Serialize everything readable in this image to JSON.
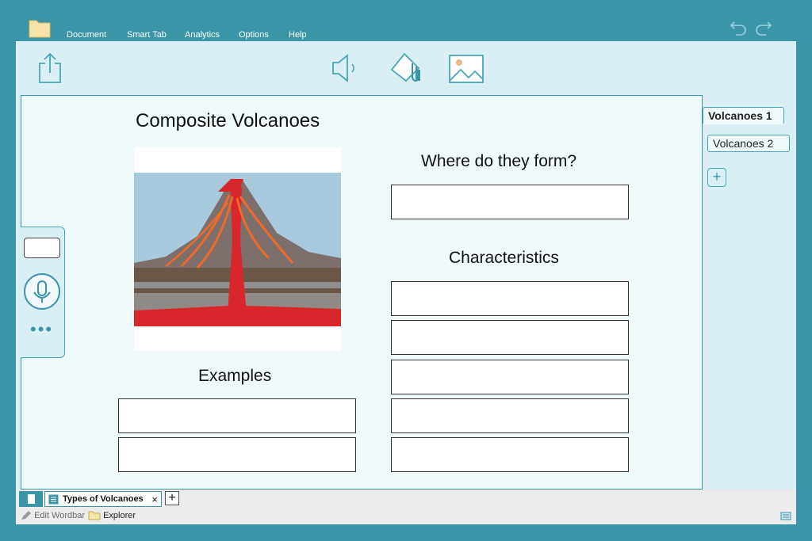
{
  "menu": {
    "items": [
      "Document",
      "Smart Tab",
      "Analytics",
      "Options",
      "Help"
    ]
  },
  "toolbar": {
    "icons": [
      "share-icon",
      "speaker-icon",
      "fill-bucket-icon",
      "image-icon"
    ]
  },
  "canvas": {
    "title": "Composite Volcanoes",
    "where_heading": "Where do they form?",
    "characteristics_heading": "Characteristics",
    "examples_heading": "Examples"
  },
  "pages": {
    "tabs": [
      "Volcanoes 1",
      "Volcanoes  2"
    ],
    "add_label": "+"
  },
  "document_tabs": {
    "active": "Types of Volcanoes",
    "close": "×",
    "add": "+"
  },
  "status": {
    "edit_wordbar": "Edit Wordbar",
    "explorer": "Explorer"
  },
  "colors": {
    "accent": "#3a95a6",
    "panel": "#d9eff4",
    "canvas": "#f1fafb"
  }
}
